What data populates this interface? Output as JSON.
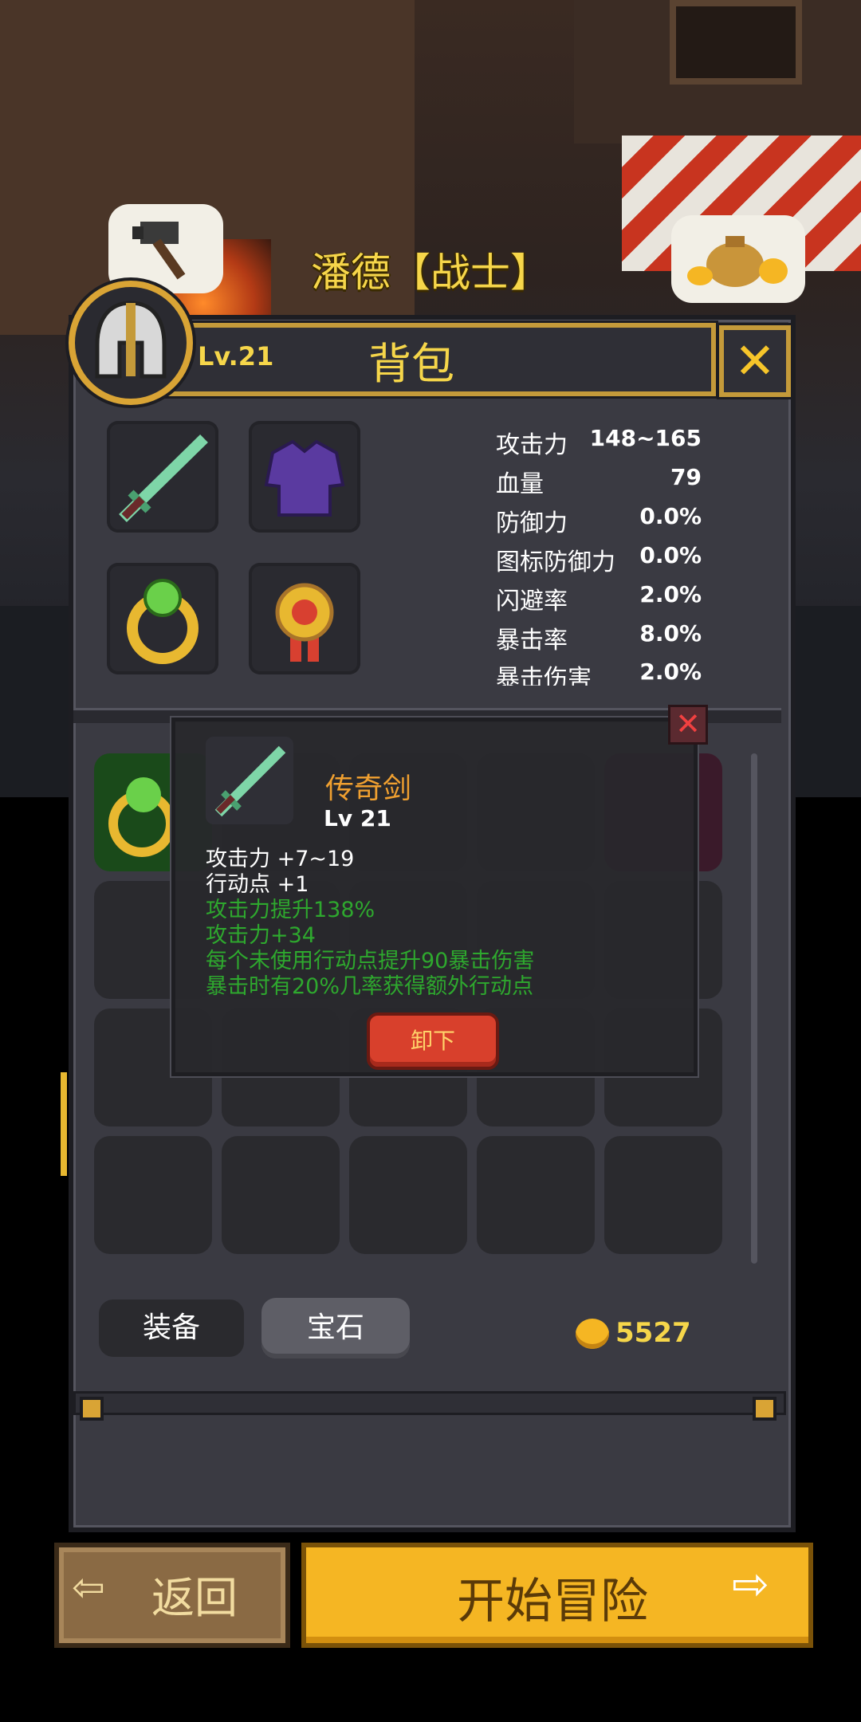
{
  "player": {
    "name": "潘德【战士】"
  },
  "backpack": {
    "title": "背包",
    "level": "Lv.21",
    "close_icon": "x-icon"
  },
  "stats": [
    {
      "label": "攻击力",
      "value": "148~165"
    },
    {
      "label": "血量",
      "value": "79"
    },
    {
      "label": "防御力",
      "value": "0.0%"
    },
    {
      "label": "图标防御力",
      "value": "0.0%"
    },
    {
      "label": "闪避率",
      "value": "2.0%"
    },
    {
      "label": "暴击率",
      "value": "8.0%"
    },
    {
      "label": "暴击伤害",
      "value": "2.0%"
    }
  ],
  "equipment": [
    "sword-icon",
    "robe-icon",
    "ring-icon",
    "medal-icon"
  ],
  "tooltip": {
    "name": "传奇剑",
    "level": "Lv 21",
    "base_stats": [
      "攻击力 +7~19",
      "行动点 +1"
    ],
    "bonus_stats": [
      "攻击力提升138%",
      "攻击力+34",
      "每个未使用行动点提升90暴击伤害",
      "暴击时有20%几率获得额外行动点"
    ],
    "unequip_label": "卸下",
    "close_icon": "x-icon"
  },
  "tabs": {
    "equip": "装备",
    "gem": "宝石"
  },
  "gold": "5527",
  "buttons": {
    "back": "返回",
    "start": "开始冒险"
  },
  "colors": {
    "accent_gold": "#f6d64a",
    "frame": "#3a3a42",
    "green_text": "#2ea82e",
    "red_button": "#d8402c",
    "start_button": "#f5b623"
  }
}
